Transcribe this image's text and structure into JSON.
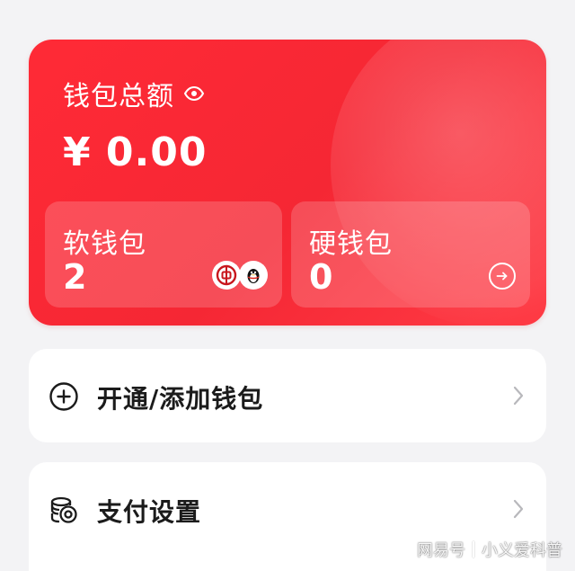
{
  "wallet": {
    "total_label": "钱包总额",
    "total_amount": "¥ 0.00",
    "soft_wallet": {
      "label": "软钱包",
      "count": "2"
    },
    "hard_wallet": {
      "label": "硬钱包",
      "count": "0"
    },
    "bank_icons": [
      "bank-of-china-icon",
      "qq-penguin-icon"
    ]
  },
  "menu": {
    "add_wallet_label": "开通/添加钱包",
    "payment_settings_label": "支付设置"
  },
  "watermark": {
    "source": "网易号",
    "author": "小义爱科普"
  },
  "colors": {
    "card_red": "#f52734",
    "text_dark": "#1b1b1b",
    "background": "#f3f3f5"
  }
}
